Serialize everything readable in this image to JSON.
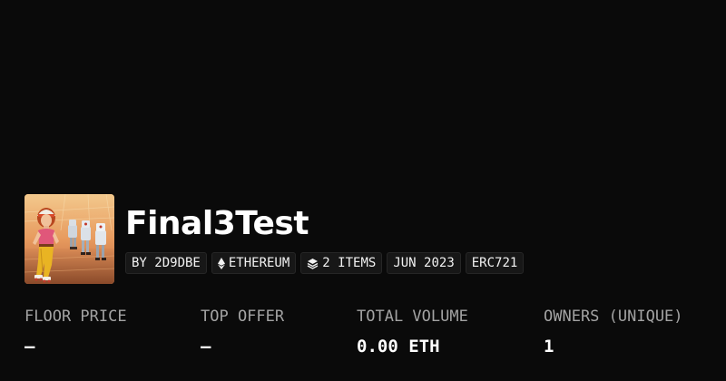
{
  "collection": {
    "name": "Final3Test",
    "avatar_icon": "collection-artwork-image"
  },
  "badges": {
    "creator": "BY 2D9DBE",
    "chain": "ETHEREUM",
    "chain_icon": "ethereum-icon",
    "items": "2 ITEMS",
    "items_icon": "layers-icon",
    "date": "JUN 2023",
    "standard": "ERC721"
  },
  "stats": {
    "floor_price": {
      "label": "FLOOR PRICE",
      "value": "—"
    },
    "top_offer": {
      "label": "TOP OFFER",
      "value": "—"
    },
    "total_volume": {
      "label": "TOTAL VOLUME",
      "value": "0.00 ETH"
    },
    "owners": {
      "label": "OWNERS (UNIQUE)",
      "value": "1"
    }
  },
  "colors": {
    "background": "#0a0a0a",
    "badge_background": "#171717",
    "label_text": "#a3a3a3",
    "value_text": "#ffffff"
  }
}
